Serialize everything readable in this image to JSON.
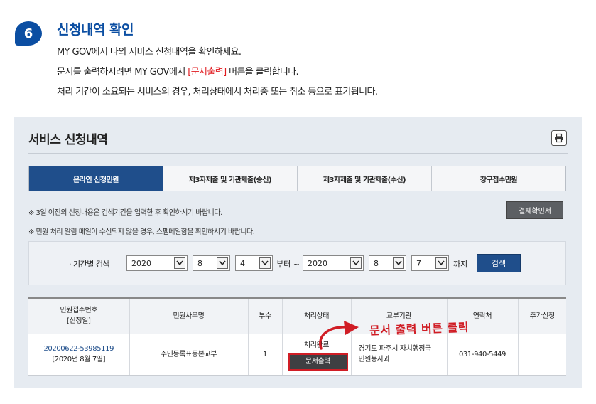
{
  "step": {
    "number": "6",
    "title": "신청내역 확인",
    "desc1": "MY GOV에서 나의 서비스 신청내역을 확인하세요.",
    "desc2_pre": "문서를 출력하시려면 MY GOV에서 ",
    "desc2_hl": "[문서출력]",
    "desc2_post": " 버튼을 클릭합니다.",
    "desc3": "처리 기간이 소요되는 서비스의 경우, 처리상태에서 처리중 또는 취소 등으로 표기됩니다."
  },
  "panel": {
    "title": "서비스 신청내역",
    "print_icon": "printer-icon",
    "tabs": [
      {
        "label": "온라인 신청민원",
        "active": true
      },
      {
        "label": "제3자제출 및 기관제출(송신)",
        "active": false
      },
      {
        "label": "제3자제출 및 기관제출(수신)",
        "active": false
      },
      {
        "label": "창구접수민원",
        "active": false
      }
    ],
    "notice1": "※ 3일 이전의 신청내용은 검색기간을 입력한 후 확인하시기 바랍니다.",
    "notice2": "※ 민원 처리 알림 메일이 수신되지 않을 경우, 스팸메일함을 확인하시기 바랍니다.",
    "confirm_button": "결제확인서"
  },
  "search": {
    "label": "· 기간별 검색",
    "from_year": "2020",
    "from_month": "8",
    "from_day": "4",
    "from_text": "부터 ~",
    "to_year": "2020",
    "to_month": "8",
    "to_day": "7",
    "to_text": "까지",
    "button": "검색"
  },
  "table": {
    "headers": [
      "민원접수번호\n[신청일]",
      "민원사무명",
      "부수",
      "처리상태",
      "교부기관",
      "연락처",
      "추가신청"
    ],
    "header_receipt_1": "민원접수번호",
    "header_receipt_2": "[신청일]",
    "rows": [
      {
        "receipt_no": "20200622-53985119",
        "date": "[2020년 8월 7일]",
        "name": "주민등록표등본교부",
        "copies": "1",
        "status": "처리완료",
        "doc_button": "문서출력",
        "agency_1": "경기도 파주시 자치행정국",
        "agency_2": "민원봉사과",
        "contact": "031-940-5449",
        "extra": ""
      }
    ]
  },
  "annotation": {
    "text": "문서 출력 버튼 클릭",
    "color": "#d01d25"
  },
  "colors": {
    "brand_blue": "#0b4ea2",
    "tab_active": "#1f4e8b",
    "panel_bg": "#e6ebf1",
    "highlight_red": "#e0191e"
  }
}
